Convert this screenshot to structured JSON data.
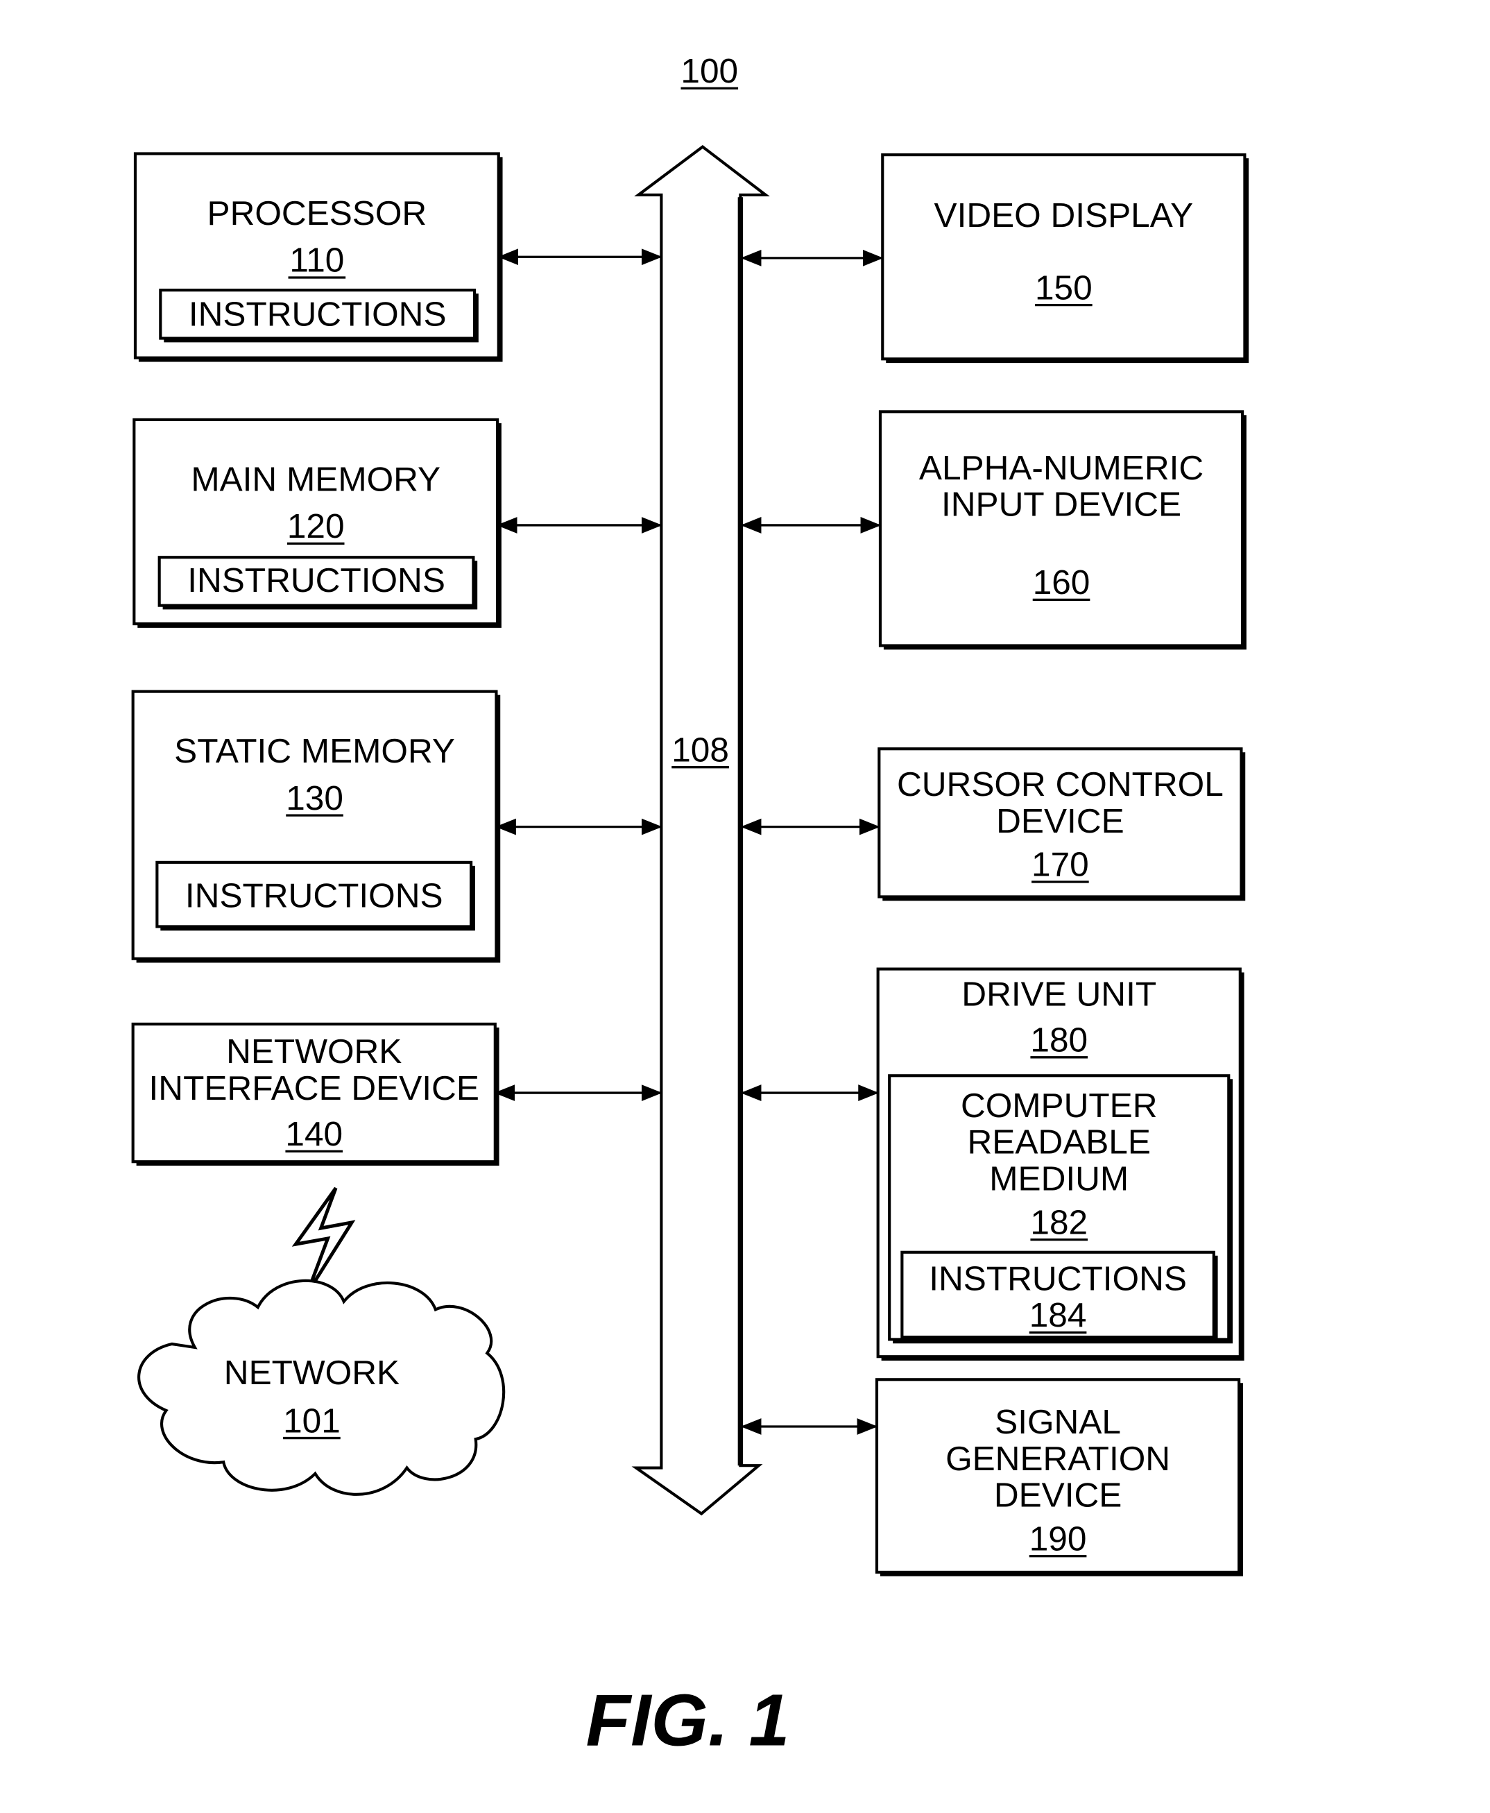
{
  "figure": {
    "reference": "100",
    "caption": "FIG. 1",
    "bus": {
      "reference": "108"
    },
    "left_blocks": [
      {
        "id": "processor",
        "title_lines": [
          "PROCESSOR"
        ],
        "reference": "110",
        "inner": {
          "label": "INSTRUCTIONS"
        }
      },
      {
        "id": "main-memory",
        "title_lines": [
          "MAIN MEMORY"
        ],
        "reference": "120",
        "inner": {
          "label": "INSTRUCTIONS"
        }
      },
      {
        "id": "static-memory",
        "title_lines": [
          "STATIC MEMORY"
        ],
        "reference": "130",
        "inner": {
          "label": "INSTRUCTIONS"
        }
      },
      {
        "id": "network-interface-device",
        "title_lines": [
          "NETWORK",
          "INTERFACE DEVICE"
        ],
        "reference": "140"
      }
    ],
    "network": {
      "title": "NETWORK",
      "reference": "101",
      "link_icon": "lightning-bolt-icon"
    },
    "right_blocks": [
      {
        "id": "video-display",
        "title_lines": [
          "VIDEO DISPLAY"
        ],
        "reference": "150"
      },
      {
        "id": "alpha-numeric-input-device",
        "title_lines": [
          "ALPHA-NUMERIC",
          "INPUT DEVICE"
        ],
        "reference": "160"
      },
      {
        "id": "cursor-control-device",
        "title_lines": [
          "CURSOR CONTROL",
          "DEVICE"
        ],
        "reference": "170"
      },
      {
        "id": "drive-unit",
        "title_lines": [
          "DRIVE UNIT"
        ],
        "reference": "180",
        "medium": {
          "title_lines": [
            "COMPUTER",
            "READABLE",
            "MEDIUM"
          ],
          "reference": "182",
          "instructions": {
            "label": "INSTRUCTIONS",
            "reference": "184"
          }
        }
      },
      {
        "id": "signal-generation-device",
        "title_lines": [
          "SIGNAL",
          "GENERATION",
          "DEVICE"
        ],
        "reference": "190"
      }
    ]
  }
}
